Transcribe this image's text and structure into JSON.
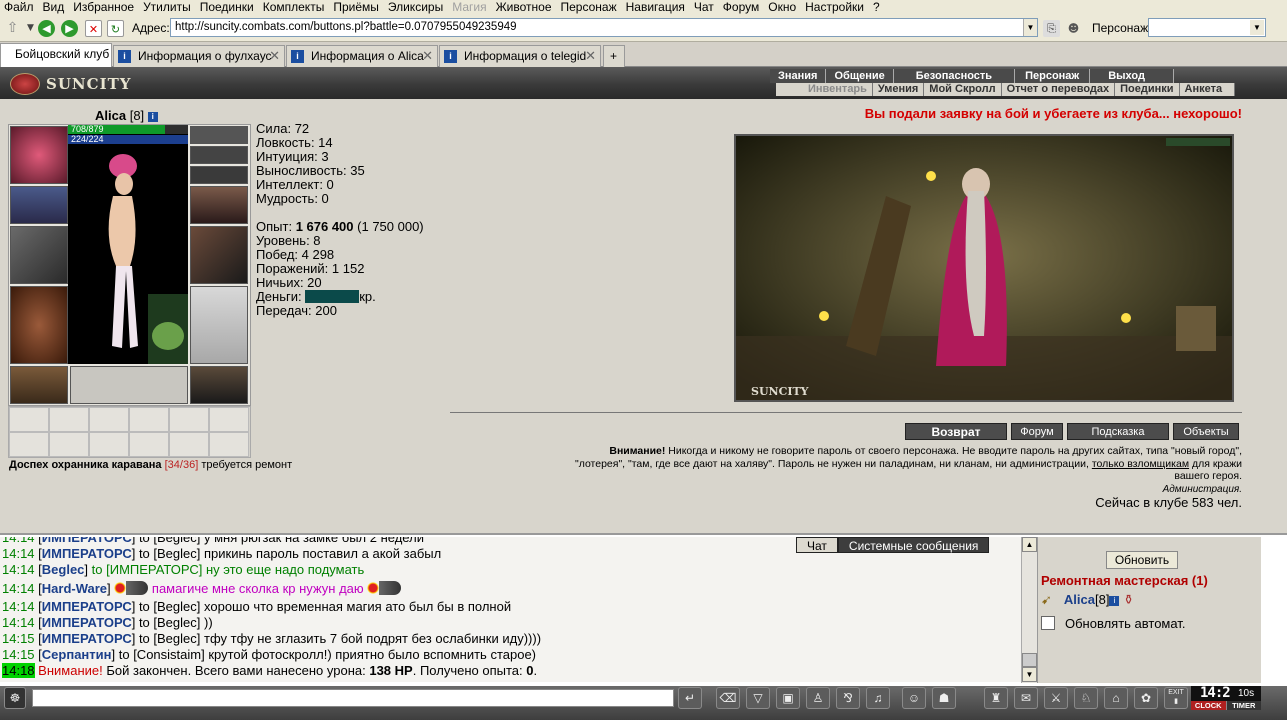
{
  "menu": [
    "Файл",
    "Вид",
    "Избранное",
    "Утилиты",
    "Поединки",
    "Комплекты",
    "Приёмы",
    "Эликсиры",
    "Магия",
    "Животное",
    "Персонаж",
    "Навигация",
    "Чат",
    "Форум",
    "Окно",
    "Настройки",
    "?"
  ],
  "address": {
    "label": "Адрес:",
    "url": "http://suncity.combats.com/buttons.pl?battle=0.0707955049235949"
  },
  "character_label": "Персонаж:",
  "tabs": [
    {
      "label": "Бойцовский клуб"
    },
    {
      "label": "Информация о фулхаус"
    },
    {
      "label": "Информация о Alica"
    },
    {
      "label": "Информация о telegid"
    }
  ],
  "game": {
    "logo": "SUNCITY",
    "topnav": [
      "Знания",
      "Общение",
      "Безопасность",
      "Персонаж",
      "Выход"
    ],
    "subnav": [
      "Инвентарь",
      "Умения",
      "Мой Скролл",
      "Отчет о переводах",
      "Поединки",
      "Анкета"
    ]
  },
  "char": {
    "name": "Alica",
    "level": "[8]",
    "hp": "708/879",
    "hp_fraction": 0.805,
    "mp": "224/224",
    "stats": [
      "Сила: 72",
      "Ловкость: 14",
      "Интуиция: 3",
      "Выносливость: 35",
      "Интеллект: 0",
      "Мудрость: 0"
    ],
    "exp_label": "Опыт: ",
    "exp_value": "1 676 400",
    "exp_next": " (1 750 000)",
    "level_line": "Уровень: 8",
    "wins": "Побед: 4 298",
    "losses": "Поражений: 1 152",
    "draws": "Ничьих: 20",
    "money_label": "Деньги: ",
    "money_unit": "кр.",
    "transfers": "Передач: 200"
  },
  "armor": {
    "name": "Доспех охранника каравана",
    "durability": "[34/36]",
    "status": "требуется ремонт"
  },
  "warning": "Вы подали заявку на бой и убегаете из клуба... нехорошо!",
  "scene_caption": "SUNCITY",
  "buttons": {
    "back": "Возврат",
    "forum": "Форум",
    "hint": "Подсказка",
    "objects": "Объекты"
  },
  "notice": {
    "bold": "Внимание!",
    "text1": " Никогда и никому не говорите пароль от своего персонажа. Не вводите пароль на других сайтах, типа \"новый город\",",
    "text2": "\"лотерея\", \"там, где все дают на халяву\". Пароль не нужен ни паладинам, ни кланам, ни администрации, ",
    "link": "только взломщикам",
    "text3": " для кражи",
    "text4": "вашего героя.",
    "admin": "Администрация.",
    "online": "Сейчас в клубе 583 чел."
  },
  "chat_tabs": [
    "Чат",
    "Системные сообщения"
  ],
  "chat": [
    {
      "time": "14:14",
      "nick": "ИМПЕРАТОРС",
      "to": "to [Beglec]",
      "msg": "у мня рюгзак на замке был 2 недели"
    },
    {
      "time": "14:14",
      "nick": "ИМПЕРАТОРС",
      "to": "to [Beglec]",
      "msg": "прикинь пароль поставил а акой забыл"
    },
    {
      "time": "14:14",
      "nick": "Beglec",
      "to": "to [ИМПЕРАТОРС]",
      "msg": "ну это еще надо подумать"
    },
    {
      "time": "14:14",
      "nick": "Hard-Ware",
      "to": "",
      "msg": "памагиче мне сколка кр нужун даю"
    },
    {
      "time": "14:14",
      "nick": "ИМПЕРАТОРС",
      "to": "to [Beglec]",
      "msg": "хорошо что временная магия ато был бы в полной"
    },
    {
      "time": "14:14",
      "nick": "ИМПЕРАТОРС",
      "to": "to [Beglec]",
      "msg": "))"
    },
    {
      "time": "14:15",
      "nick": "ИМПЕРАТОРС",
      "to": "to [Beglec]",
      "msg": "тфу тфу не зглазить 7 бой подрят без ослабинки иду))))"
    },
    {
      "time": "14:15",
      "nick": "Серпантин",
      "to": "to [Consistaim]",
      "msg": "крутой фотоскролл!) приятно было вспомнить старое)"
    },
    {
      "time": "14:18",
      "sys": "Внимание!",
      "msg": " Бой закончен. Всего вами нанесено урона: ",
      "dmg": "138 HP",
      "msg2": ". Получено опыта: ",
      "exp": "0",
      "end": "."
    }
  ],
  "side": {
    "refresh": "Обновить",
    "room": "Ремонтная мастерская (1)",
    "user": "Alica",
    "user_level": "[8]",
    "auto": "Обновлять автомат."
  },
  "clock": {
    "time": "14:2",
    "sec": "10s",
    "clock_label": "CLOCK",
    "timer_label": "TIMER"
  }
}
